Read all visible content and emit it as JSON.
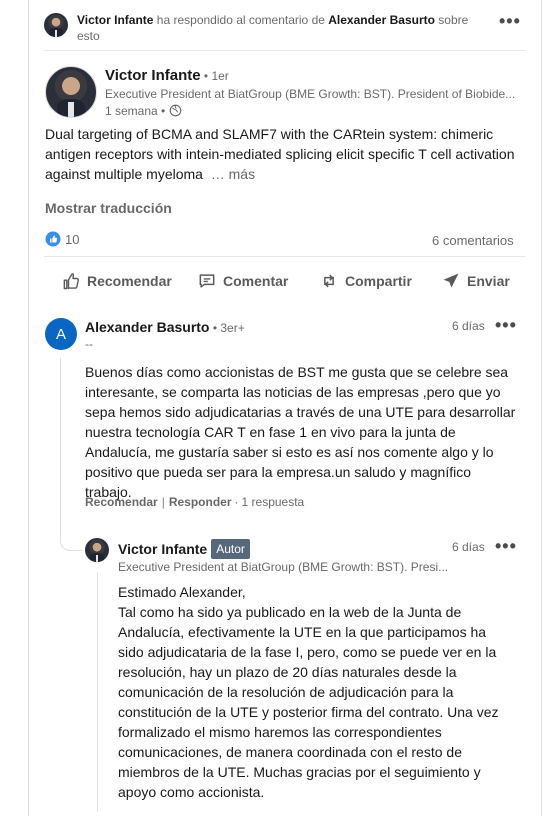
{
  "activity": {
    "actor": "Victor Infante",
    "verb": " ha respondido al comentario de ",
    "target": "Alexander Basurto",
    "tail1": " sobre",
    "tail2": "esto",
    "menu": "•••"
  },
  "post": {
    "author": "Victor Infante",
    "degree": " • 1er",
    "headline": "Executive President at BiatGroup (BME Growth: BST). President of Biobide...",
    "time": "1 semana • ",
    "text": "Dual targeting of BCMA and SLAMF7 with the CARtein system: chimeric antigen receptors with intein-mediated splicing elicit specific T cell activation against multiple myeloma",
    "more": "… más",
    "translate": "Mostrar traducción",
    "reactions_count": "10",
    "comments_count": "6 comentarios"
  },
  "actions": {
    "like": "Recomendar",
    "comment": "Comentar",
    "share": "Compartir",
    "send": "Enviar"
  },
  "comment1": {
    "avatar_letter": "A",
    "author": "Alexander Basurto",
    "degree": " • 3er+",
    "subtitle": "--",
    "time": "6 días",
    "text": "Buenos días como accionistas de BST me gusta que se celebre sea interesante, se comparta las noticias de las empresas ,pero que yo sepa hemos sido adjudicatarias a través de una UTE para desarrollar nuestra tecnología CAR T en fase 1 en vivo para la junta de Andalucía, me gustaría saber si esto es así nos comente algo y lo positivo que pueda ser para la empresa.un saludo y magnífico trabajo.",
    "like": "Recomendar",
    "reply": "Responder",
    "replies": "1 respuesta",
    "menu": "•••"
  },
  "reply1": {
    "author": "Victor Infante",
    "badge": "Autor",
    "headline": "Executive President at BiatGroup (BME Growth: BST). Presi...",
    "time": "6 días",
    "menu": "•••",
    "greeting": "Estimado Alexander,",
    "text": "Tal como ha sido ya publicado en la web de la Junta de Andalucía, efectivamente la UTE en la que participamos ha sido adjudicataria de la fase I, pero, como se puede ver en la resolución, hay un plazo de 20 días naturales desde la comunicación de la resolución de adjudicación para la constitución de la UTE y posterior firma del contrato. Una vez formalizado el mismo haremos las correspondientes comunicaciones, de manera coordinada con el resto de miembros de la UTE. Muchas gracias por el seguimiento y apoyo como accionista."
  },
  "colors": {
    "link_blue": "#0a66c2",
    "badge": "#56687a",
    "avatar_a": "#0a66c2"
  }
}
